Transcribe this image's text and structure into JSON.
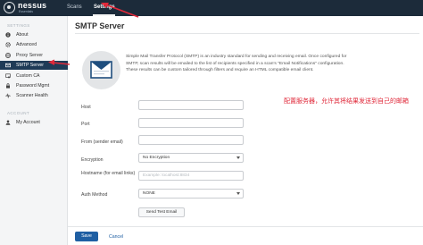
{
  "brand": {
    "name": "nessus",
    "sub": "Essentials"
  },
  "topnav": {
    "items": [
      {
        "label": "Scans",
        "active": false
      },
      {
        "label": "Settings",
        "active": true
      }
    ]
  },
  "sidebar": {
    "section_settings": "SETTINGS",
    "settings_items": [
      {
        "label": "About",
        "icon": "info-icon"
      },
      {
        "label": "Advanced",
        "icon": "gear-icon"
      },
      {
        "label": "Proxy Server",
        "icon": "globe-icon"
      },
      {
        "label": "SMTP Server",
        "icon": "mail-icon",
        "active": true
      },
      {
        "label": "Custom CA",
        "icon": "certificate-icon"
      },
      {
        "label": "Password Mgmt",
        "icon": "lock-icon"
      },
      {
        "label": "Scanner Health",
        "icon": "heartbeat-icon"
      }
    ],
    "section_account": "ACCOUNT",
    "account_items": [
      {
        "label": "My Account",
        "icon": "user-icon"
      }
    ]
  },
  "main": {
    "title": "SMTP Server",
    "description": "Simple Mail Transfer Protocol (SMTP) is an industry standard for sending and receiving email. Once configured for SMTP, scan results will be emailed to the list of recipients specified in a scan's \"Email Notifications\" configuration. These results can be custom tailored through filters and require an HTML compatible email client.",
    "fields": {
      "host": {
        "label": "Host",
        "value": ""
      },
      "port": {
        "label": "Port",
        "value": ""
      },
      "from": {
        "label": "From (sender email)",
        "value": ""
      },
      "encryption": {
        "label": "Encryption",
        "value": "No Encryption"
      },
      "hostname": {
        "label": "Hostname (for email links)",
        "placeholder": "Example: localhost:8834"
      },
      "auth": {
        "label": "Auth Method",
        "value": "NONE"
      }
    },
    "send_test_label": "Send Test Email",
    "save_label": "Save",
    "cancel_label": "Cancel"
  },
  "annotation": {
    "text": "配置服务器，允许其将结果发送到自己的邮箱",
    "color": "#e0293a"
  },
  "colors": {
    "topbar": "#1c2b3a",
    "sidebar_active": "#1f3b57",
    "primary_button": "#1f5fa3",
    "arrow": "#e0293a"
  }
}
